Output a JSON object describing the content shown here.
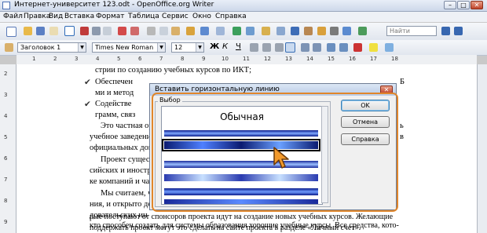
{
  "window": {
    "title": "Интернет-университет 123.odt - OpenOffice.org Writer"
  },
  "menu": [
    "Файл",
    "Правка",
    "Вид",
    "Вставка",
    "Формат",
    "Таблица",
    "Сервис",
    "Окно",
    "Справка"
  ],
  "toolbar": {
    "find_placeholder": "Найти"
  },
  "format": {
    "style": "Заголовок 1",
    "font": "Times New Roman",
    "size": "12",
    "bold": "Ж",
    "italic": "К",
    "underline": "Ч"
  },
  "ruler": {
    "h_ticks": [
      "1",
      "2",
      "3",
      "4",
      "5",
      "6",
      "7",
      "8",
      "9",
      "10",
      "11",
      "12",
      "13",
      "14",
      "15",
      "16",
      "17",
      "18"
    ],
    "v_ticks": [
      "2",
      "3",
      "4",
      "5",
      "6",
      "7",
      "8",
      "9"
    ]
  },
  "document": {
    "lines": [
      "стрии по созданию учебных курсов по ИКТ;",
      "Обеспечен",
      "ми и метод",
      "Содействе",
      "грамм, связ",
      "Это частная ор",
      "учебное заведени",
      "официальных док",
      "Проект сущест",
      "сийских и иностр",
      "ке компаний и час",
      "Мы считаем, ч",
      "ния, и открыто де",
      "довательских ин",
      "кто способен создать для системы образования хорошие учебные курсы. Все средства, кото-",
      "рые поступают от спонсоров проекта идут на создание новых учебных курсов. Желающие",
      "поддержать проект могут это сделать на сайте проекта в разделе «Личный счет»."
    ],
    "right_fragments": [
      "Б",
      "ь",
      "в"
    ],
    "bullet": "✔"
  },
  "dialog": {
    "title": "Вставить горизонтальную линию",
    "group_label": "Выбор",
    "first_item": "Обычная",
    "buttons": {
      "ok": "OK",
      "cancel": "Отмена",
      "help": "Справка"
    }
  },
  "colors": {
    "highlight": "#e0862b",
    "selection": "#000000"
  }
}
